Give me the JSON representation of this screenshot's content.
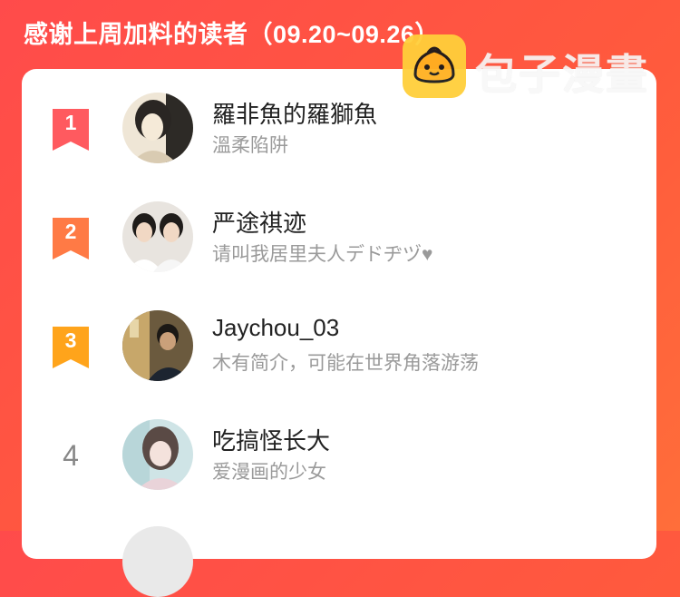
{
  "header": {
    "title": "感谢上周加料的读者（09.20~09.26）"
  },
  "watermark": {
    "text": "包子漫畫",
    "icon": "bun-mascot-icon"
  },
  "readers": [
    {
      "rank": "1",
      "name": "羅非魚的羅獅魚",
      "desc": "溫柔陷阱",
      "badge_color": "#ff5a5f"
    },
    {
      "rank": "2",
      "name": "严途祺迹",
      "desc": "请叫我居里夫人デドヂヅ♥",
      "badge_color": "#ff7a45"
    },
    {
      "rank": "3",
      "name": "Jaychou_03",
      "desc": "木有简介，可能在世界角落游荡",
      "badge_color": "#ffa41b"
    },
    {
      "rank": "4",
      "name": "吃搞怪长大",
      "desc": "爱漫画的少女",
      "badge_color": "#888888"
    }
  ],
  "colors": {
    "background": "#ff4b4b",
    "card": "#ffffff",
    "watermark_icon": "#ffcf3a"
  }
}
